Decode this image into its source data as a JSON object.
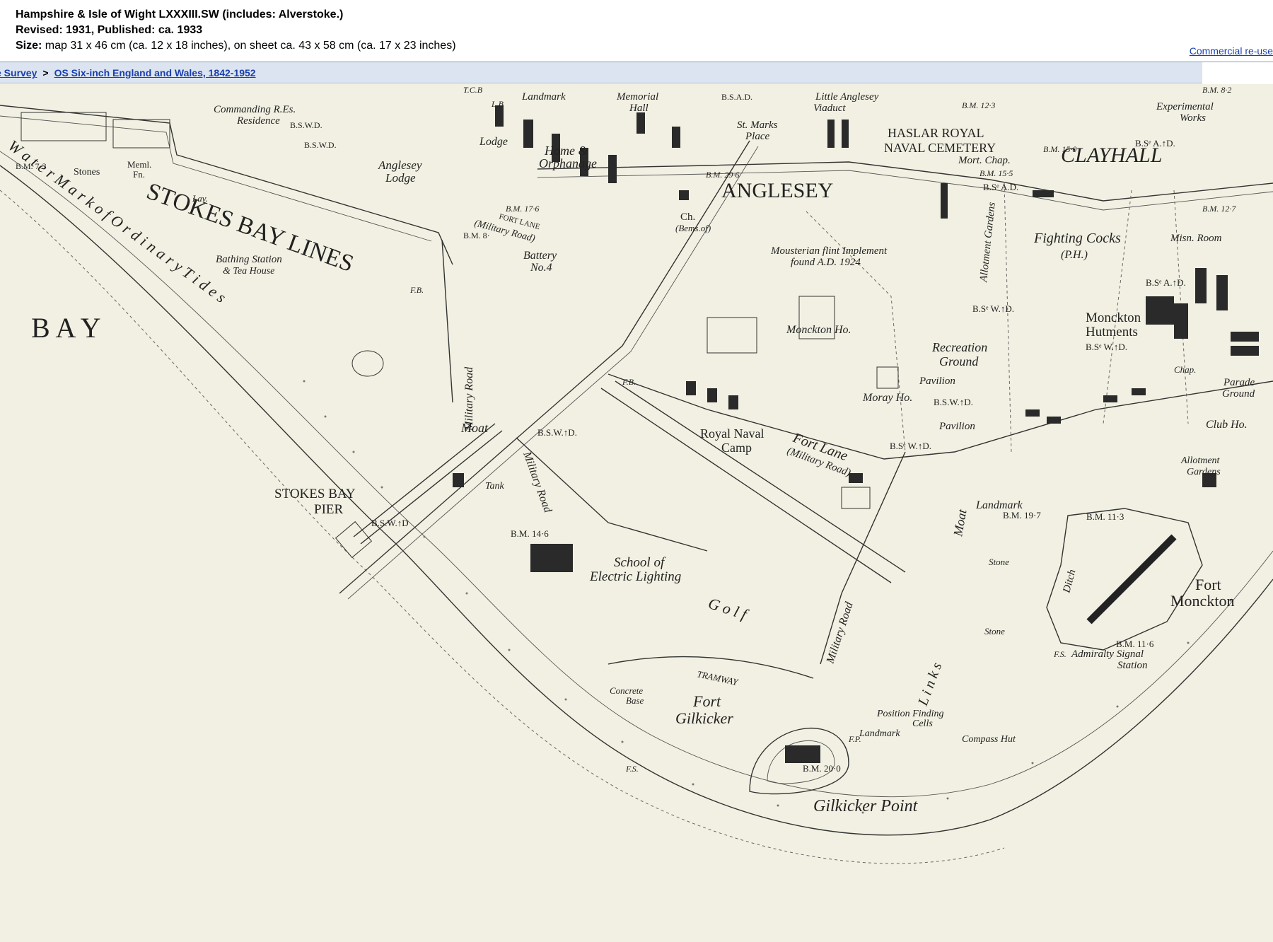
{
  "header": {
    "title": "Hampshire & Isle of Wight LXXXIII.SW (includes: Alverstoke.)",
    "revised": "Revised: 1931, Published: ca. 1933",
    "size_label": "Size:",
    "size_text": "map 31 x 46 cm (ca. 12 x 18 inches), on sheet ca. 43 x 58 cm (ca. 17 x 23 inches)",
    "reuse_link": "Commercial re-use"
  },
  "breadcrumb": {
    "item1": "e Survey",
    "separator": ">",
    "item2": "OS Six-inch England and Wales, 1842-1952"
  },
  "map": {
    "labels": {
      "stokes_bay_lines": "STOKES BAY LINES",
      "bay": "B A Y",
      "water_mark": "W a t e r   M a r k   o f   O r d i n a r y   T i d e s",
      "anglesey": "ANGLESEY",
      "clayhall": "CLAYHALL",
      "haslar": "HASLAR ROYAL",
      "naval_cemetery": "NAVAL CEMETERY",
      "mort_chap": "Mort. Chap.",
      "fighting_cocks": "Fighting Cocks",
      "ph": "(P.H.)",
      "misn_room": "Misn. Room",
      "experimental": "Experimental",
      "works": "Works",
      "commanding": "Commanding R.Es.",
      "residence": "Residence",
      "memorial_hall": "Memorial",
      "hall": "Hall",
      "landmark_top": "Landmark",
      "lodge": "Lodge",
      "home": "Home &",
      "orphanage": "Orphanage",
      "anglesey_lodge": "Anglesey",
      "anglesey_lodge2": "Lodge",
      "st_marks": "St. Marks",
      "place": "Place",
      "little_anglesey": "Little Anglesey",
      "viaduct": "Viaduct",
      "stones": "Stones",
      "meml": "Meml.",
      "fn": "Fn.",
      "lav": "Lav.",
      "bathing_station": "Bathing Station",
      "tea_house": "& Tea House",
      "battery": "Battery",
      "no4": "No.4",
      "fort_lane_top": "FORT LANE",
      "military_road_top": "(Military Road)",
      "ch": "Ch.",
      "bems": "(Bems.of)",
      "mousterian": "Mousterian flint Implement",
      "found": "found A.D. 1924",
      "allotment_gardens": "Allotment Gardens",
      "moncton_ho": "Monckton Ho.",
      "recreation": "Recreation",
      "ground": "Ground",
      "pavilion1": "Pavilion",
      "pavilion2": "Pavilion",
      "moray_ho": "Moray Ho.",
      "monckton_hutments": "Monckton",
      "hutments": "Hutments",
      "parade_ground": "Parade",
      "parade_ground2": "Ground",
      "club_ho": "Club Ho.",
      "chap": "Chap.",
      "military_road_v1": "Military Road",
      "military_road_v2": "Military Road",
      "military_road_v3": "Military Road",
      "moat1": "Moat",
      "moat2": "Moat",
      "royal_naval": "Royal Naval",
      "camp": "Camp",
      "fort_lane": "Fort Lane",
      "fort_lane_mil": "(Military Road)",
      "stokes_bay_pier": "STOKES BAY",
      "pier": "PIER",
      "tank": "Tank",
      "school_of": "School of",
      "electric_lighting": "Electric Lighting",
      "golf": "G o l f",
      "tramway": "TRAMWAY",
      "fort_gilkicker": "Fort",
      "gilkicker": "Gilkicker",
      "concrete": "Concrete",
      "base": "Base",
      "gilkicker_point": "Gilkicker Point",
      "position_finding": "Position Finding",
      "cells": "Cells",
      "landmark_bottom": "Landmark",
      "compass_hut": "Compass Hut",
      "landmark_right": "Landmark",
      "stone1": "Stone",
      "stone2": "Stone",
      "ditch": "Ditch",
      "fort_monckton": "Fort",
      "monckton": "Monckton",
      "admiralty": "Admiralty Signal",
      "station": "Station",
      "allotment_gardens2": "Allotment",
      "gardens2": "Gardens",
      "links": "L i n k s",
      "bm_73": "B.M. 7·3",
      "bm_176": "B.M. 17·6",
      "bm_296": "B.M. 29·6",
      "bm_123": "B.M. 12·3",
      "bm_155": "B.M. 15·5",
      "bm_150": "B.M. 15·0",
      "bm_127": "B.M. 12·7",
      "bm_82": "B.M. 8·2",
      "bm_146": "B.M. 14·6",
      "bm_197": "B.M. 19·7",
      "bm_113": "B.M. 11·3",
      "bm_116": "B.M. 11·6",
      "bm_200": "B.M. 20·0",
      "bm_8": "B.M. 8·",
      "bsw_1": "B.S.W.D.",
      "bsw_2": "B.S.W.D.",
      "bsw_3": "B.S.W.↑D.",
      "bsw_4": "B.S.W.↑D.",
      "bsw_5": "B.S.W.↑D",
      "bsw_6": "B.Sᵉ W.↑D.",
      "bsw_7": "B.Sᵉ W.↑D.",
      "bsw_8": "B.Sᵉ W.↑D.",
      "bsa_1": "B.S.A.D.",
      "bsa_2": "B.Sᵉ A.↑D.",
      "bsa_3": "B.Sᵉ A.↑D.",
      "bsa_4": "B.Sᵉ A.D.",
      "fb": "F.B.",
      "fb2": "F.B.",
      "fs": "F.S.",
      "fs2": "F.S.",
      "fp": "F.P.",
      "lb": "L.B",
      "tcb": "T.C.B"
    },
    "colors": {
      "paper": "#f1f0e2",
      "ink": "#222222",
      "link": "#1a3fae",
      "breadcrumb_bg": "#dbe4f0"
    }
  }
}
